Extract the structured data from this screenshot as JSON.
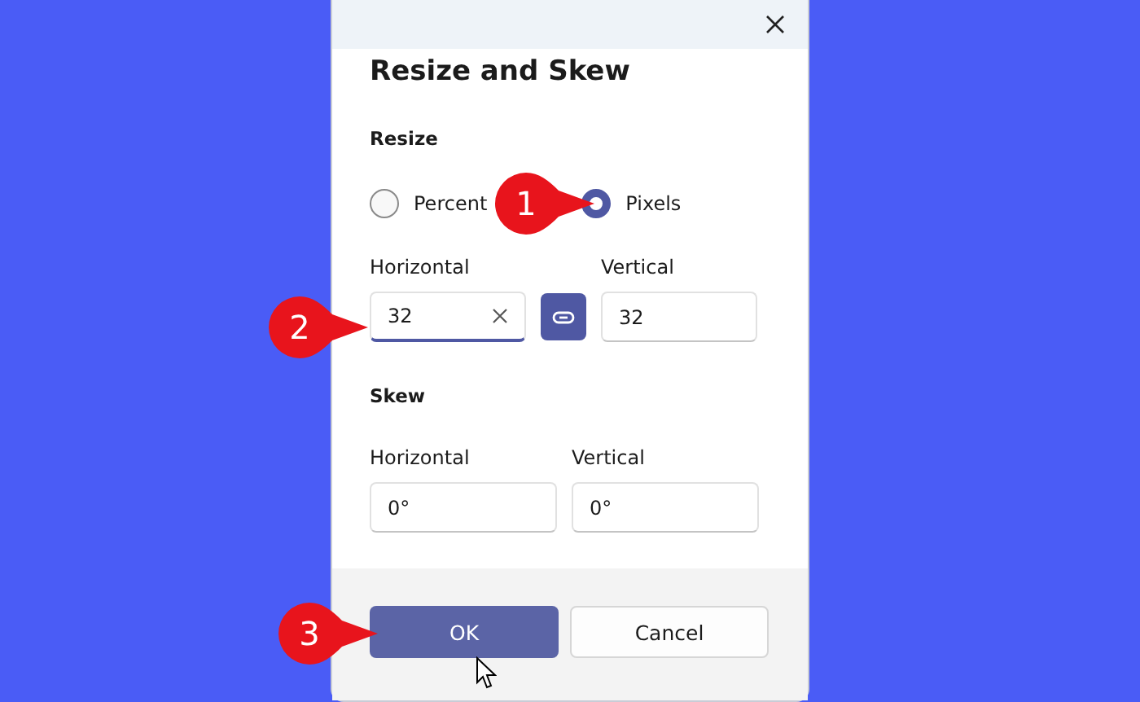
{
  "title": "Resize and Skew",
  "resize": {
    "heading": "Resize",
    "options": [
      {
        "label": "Percent",
        "selected": false
      },
      {
        "label": "Pixels",
        "selected": true
      }
    ],
    "fields": [
      {
        "label": "Horizontal",
        "value": "32",
        "focused": true
      },
      {
        "label": "Vertical",
        "value": "32",
        "focused": false
      }
    ],
    "lock_aspect": {
      "on": true
    }
  },
  "skew": {
    "heading": "Skew",
    "fields": [
      {
        "label": "Horizontal",
        "value": "0°"
      },
      {
        "label": "Vertical",
        "value": "0°"
      }
    ]
  },
  "buttons": [
    {
      "label": "OK",
      "kind": "primary"
    },
    {
      "label": "Cancel",
      "kind": "secondary"
    }
  ],
  "callouts": [
    "1",
    "2",
    "3"
  ]
}
